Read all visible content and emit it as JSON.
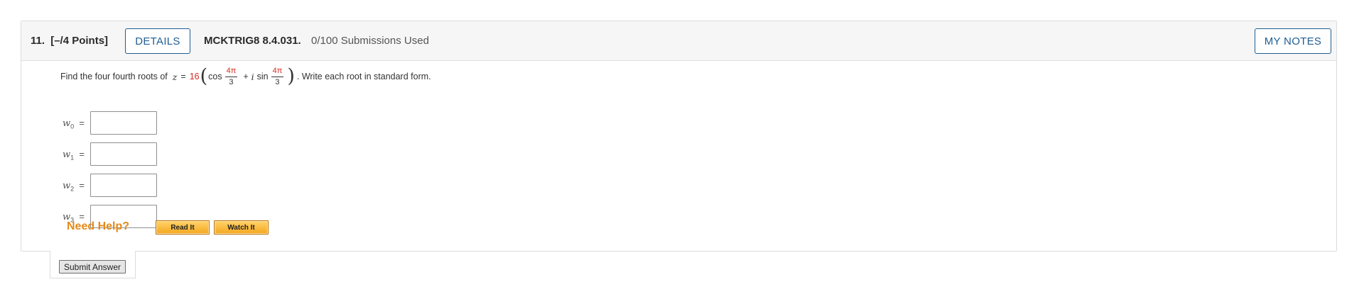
{
  "question": {
    "number": "11.",
    "points": "[–/4 Points]",
    "details_label": "DETAILS",
    "code": "MCKTRIG8 8.4.031.",
    "submissions": "0/100 Submissions Used",
    "notes_label": "MY NOTES"
  },
  "prompt": {
    "lead": "Find the four fourth roots of",
    "z_var": "z",
    "equals": "=",
    "modulus": "16",
    "cos": "cos",
    "angle_num": "4π",
    "angle_den": "3",
    "plus": "+",
    "i": "i",
    "sin": "sin",
    "angle_num2": "4π",
    "angle_den2": "3",
    "tail": ". Write each root in standard form."
  },
  "answers": [
    {
      "var": "w",
      "sub": "0",
      "eq": "=",
      "value": ""
    },
    {
      "var": "w",
      "sub": "1",
      "eq": "=",
      "value": ""
    },
    {
      "var": "w",
      "sub": "2",
      "eq": "=",
      "value": ""
    },
    {
      "var": "w",
      "sub": "3",
      "eq": "=",
      "value": ""
    }
  ],
  "help": {
    "title": "Need Help?",
    "read_label": "Read It",
    "watch_label": "Watch It"
  },
  "submit": {
    "label": "Submit Answer"
  },
  "colors": {
    "accent_blue": "#1f5e92",
    "help_orange": "#e48a1a",
    "math_red": "#d62a1f"
  }
}
